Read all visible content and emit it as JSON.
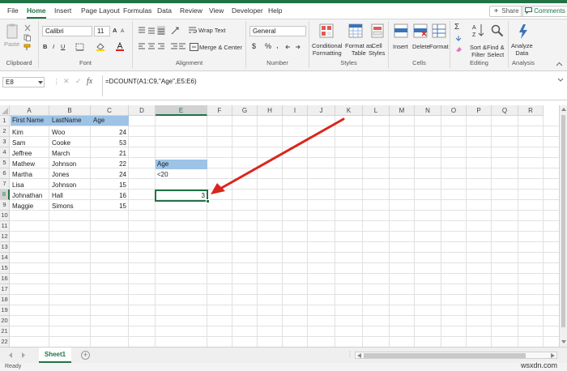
{
  "tabs": {
    "items": [
      "File",
      "Home",
      "Insert",
      "Page Layout",
      "Formulas",
      "Data",
      "Review",
      "View",
      "Developer",
      "Help"
    ],
    "active": "Home",
    "share": "Share",
    "comments": "Comments"
  },
  "ribbon": {
    "clipboard": {
      "label": "Clipboard",
      "paste": "Paste"
    },
    "font": {
      "label": "Font",
      "name": "Calibri",
      "size": "11"
    },
    "alignment": {
      "label": "Alignment",
      "wrap": "Wrap Text",
      "merge": "Merge & Center"
    },
    "number": {
      "label": "Number",
      "format": "General",
      "currency": "$",
      "percent": "%",
      "comma": ","
    },
    "styles": {
      "label": "Styles",
      "conditional": "Conditional",
      "conditional2": "Formatting",
      "formatas": "Format as",
      "formatas2": "Table",
      "cell": "Cell",
      "cell2": "Styles"
    },
    "cells": {
      "label": "Cells",
      "insert": "Insert",
      "delete": "Delete",
      "format": "Format"
    },
    "editing": {
      "label": "Editing",
      "sort": "Sort &",
      "sort2": "Filter",
      "find": "Find &",
      "find2": "Select"
    },
    "analysis": {
      "label": "Analysis",
      "analyze": "Analyze",
      "analyze2": "Data"
    }
  },
  "formula_bar": {
    "name_box": "E8",
    "formula": "=DCOUNT(A1:C9,\"Age\",E5:E6)"
  },
  "columns": [
    "A",
    "B",
    "C",
    "D",
    "E",
    "F",
    "G",
    "H",
    "I",
    "J",
    "K",
    "L",
    "M",
    "N",
    "O",
    "P",
    "Q",
    "R"
  ],
  "rows": [
    "1",
    "2",
    "3",
    "4",
    "5",
    "6",
    "7",
    "8",
    "9",
    "10",
    "11",
    "12",
    "13",
    "14",
    "15",
    "16",
    "17",
    "18",
    "19",
    "20",
    "21",
    "22"
  ],
  "table": {
    "headers": [
      "First Name",
      "LastName",
      "Age"
    ],
    "rows": [
      [
        "Kim",
        "Woo",
        "24"
      ],
      [
        "Sam",
        "Cooke",
        "53"
      ],
      [
        "Jeffree",
        "March",
        "21"
      ],
      [
        "Mathew",
        "Johnson",
        "22"
      ],
      [
        "Martha",
        "Jones",
        "24"
      ],
      [
        "Lisa",
        "Johnson",
        "15"
      ],
      [
        "Johnathan",
        "Hall",
        "16"
      ],
      [
        "Maggie",
        "Simons",
        "15"
      ]
    ]
  },
  "criteria": {
    "header": "Age",
    "value": "<20"
  },
  "result": "3",
  "sheet": {
    "tab": "Sheet1"
  },
  "status": {
    "ready": "Ready"
  },
  "watermark": "wsxdn.com",
  "colors": {
    "accent": "#217346",
    "header_fill": "#9dc3e6",
    "arrow": "#d9261c"
  }
}
